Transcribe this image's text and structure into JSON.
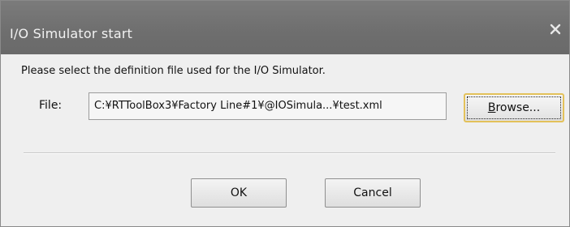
{
  "window": {
    "title": "I/O Simulator start",
    "close_glyph": "×",
    "close_icon": "close-icon"
  },
  "message": "Please select the definition file used for the I/O Simulator.",
  "file": {
    "label": "File:",
    "value": "C:¥RTToolBox3¥Factory Line#1¥@IOSimula...¥test.xml"
  },
  "buttons": {
    "browse_mnemonic": "B",
    "browse_rest": "rowse...",
    "ok": "OK",
    "cancel": "Cancel"
  },
  "colors": {
    "titlebar": "#6e6e6e",
    "focus_border": "#e3c15a"
  }
}
